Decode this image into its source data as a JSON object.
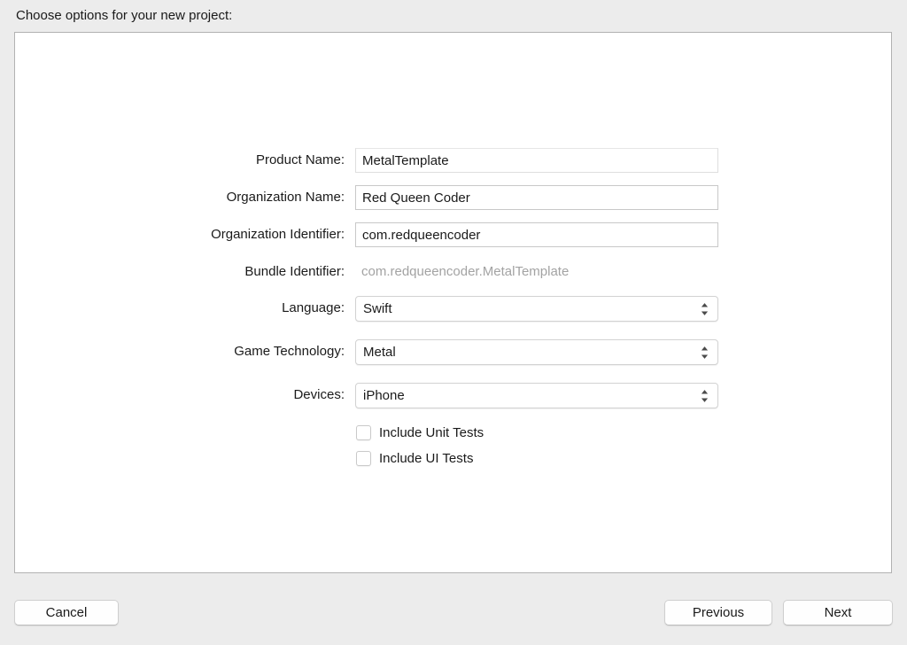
{
  "header": {
    "title": "Choose options for your new project:"
  },
  "form": {
    "fields": [
      {
        "label": "Product Name:",
        "value": "MetalTemplate",
        "type": "textfield",
        "name": "product-name",
        "style": "faint"
      },
      {
        "label": "Organization Name:",
        "value": "Red Queen Coder",
        "type": "textfield",
        "name": "organization-name",
        "style": "normal"
      },
      {
        "label": "Organization Identifier:",
        "value": "com.redqueencoder",
        "type": "textfield",
        "name": "organization-identifier",
        "style": "normal"
      },
      {
        "label": "Bundle Identifier:",
        "value": "com.redqueencoder.MetalTemplate",
        "type": "static",
        "name": "bundle-identifier",
        "style": "readonly"
      },
      {
        "label": "Language:",
        "value": "Swift",
        "type": "popup",
        "name": "language",
        "style": "normal"
      },
      {
        "label": "Game Technology:",
        "value": "Metal",
        "type": "popup",
        "name": "game-technology",
        "style": "normal"
      },
      {
        "label": "Devices:",
        "value": "iPhone",
        "type": "popup",
        "name": "devices",
        "style": "normal"
      }
    ],
    "checkboxes": [
      {
        "label": "Include Unit Tests",
        "checked": false,
        "name": "include-unit-tests"
      },
      {
        "label": "Include UI Tests",
        "checked": false,
        "name": "include-ui-tests"
      }
    ]
  },
  "buttons": {
    "cancel": "Cancel",
    "previous": "Previous",
    "next": "Next"
  },
  "icons": {
    "popup_indicator": "chevron-up-down-icon",
    "checkbox": "checkbox-unchecked-icon"
  },
  "colors": {
    "window_background": "#ececec",
    "panel_background": "#ffffff",
    "panel_border": "#b2b2b2",
    "text_primary": "#1a1a1a",
    "text_disabled": "#a3a3a3",
    "field_border": "#c8c8c8",
    "field_border_faint": "#dedede"
  }
}
